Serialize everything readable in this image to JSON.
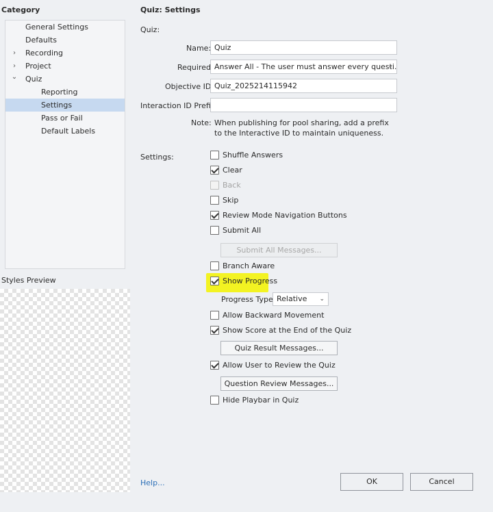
{
  "category": {
    "header": "Category",
    "items": [
      {
        "label": "General Settings",
        "expander": ""
      },
      {
        "label": "Defaults",
        "expander": ""
      },
      {
        "label": "Recording",
        "expander": "›"
      },
      {
        "label": "Project",
        "expander": "›"
      },
      {
        "label": "Quiz",
        "expander": "⌄"
      },
      {
        "label": "Reporting",
        "expander": ""
      },
      {
        "label": "Settings",
        "expander": "",
        "selected": true
      },
      {
        "label": "Pass or Fail",
        "expander": ""
      },
      {
        "label": "Default Labels",
        "expander": ""
      }
    ]
  },
  "styles_preview": {
    "label": "Styles Preview"
  },
  "panel": {
    "title": "Quiz: Settings",
    "quiz_section": "Quiz:",
    "name_label": "Name:",
    "name_value": "Quiz",
    "required_label": "Required:",
    "required_value": "Answer All - The user must answer every questi...",
    "objective_label": "Objective ID:",
    "objective_value": "Quiz_2025214115942",
    "interaction_label": "Interaction ID Prefix:",
    "interaction_value": "",
    "note_label": "Note:",
    "note_line1": "When publishing for pool sharing, add a prefix",
    "note_line2": "to the Interactive ID to maintain uniqueness.",
    "settings_label": "Settings:",
    "checkboxes": {
      "shuffle": {
        "label": "Shuffle Answers",
        "checked": false
      },
      "clear": {
        "label": "Clear",
        "checked": true
      },
      "back": {
        "label": "Back",
        "checked": false,
        "disabled": true
      },
      "skip": {
        "label": "Skip",
        "checked": false
      },
      "review_nav": {
        "label": "Review Mode Navigation Buttons",
        "checked": true
      },
      "submit_all": {
        "label": "Submit All",
        "checked": false
      },
      "branch_aware": {
        "label": "Branch Aware",
        "checked": false
      },
      "show_progress": {
        "label": "Show Progress",
        "checked": true
      },
      "allow_backward": {
        "label": "Allow Backward Movement",
        "checked": false
      },
      "show_score": {
        "label": "Show Score at the End of the Quiz",
        "checked": true
      },
      "allow_review": {
        "label": "Allow User to Review the Quiz",
        "checked": true
      },
      "hide_playbar": {
        "label": "Hide Playbar in Quiz",
        "checked": false
      }
    },
    "submit_all_messages_btn": "Submit All Messages...",
    "progress_type_label": "Progress Type:",
    "progress_type_value": "Relative",
    "quiz_result_messages_btn": "Quiz Result Messages...",
    "question_review_messages_btn": "Question Review Messages..."
  },
  "footer": {
    "help": "Help...",
    "ok": "OK",
    "cancel": "Cancel"
  },
  "colors": {
    "highlight": "#f3f322",
    "selection": "#c6d9f0",
    "link": "#2c6fb7"
  }
}
